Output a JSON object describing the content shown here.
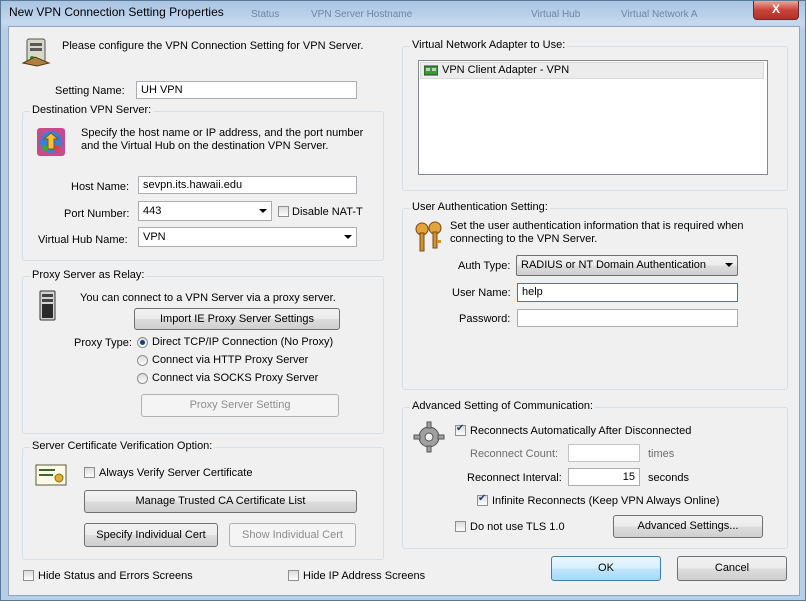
{
  "window": {
    "title": "New VPN Connection Setting Properties",
    "background_headers": [
      "Status",
      "VPN Server Hostname",
      "Virtual Hub",
      "Virtual Network A"
    ],
    "close_label": "X"
  },
  "intro": {
    "text": "Please configure the VPN Connection Setting for VPN Server."
  },
  "setting_name": {
    "label": "Setting Name:",
    "value": "UH VPN"
  },
  "destination": {
    "title": "Destination VPN Server:",
    "description": [
      "Specify the host name or IP address, and the port number",
      "and the Virtual Hub on the destination VPN Server."
    ],
    "host_label": "Host Name:",
    "host_value": "sevpn.its.hawaii.edu",
    "port_label": "Port Number:",
    "port_value": "443",
    "nat_label": "Disable NAT-T",
    "hub_label": "Virtual Hub Name:",
    "hub_value": "VPN"
  },
  "proxy": {
    "title": "Proxy Server as Relay:",
    "description": "You can connect to a VPN Server via a proxy server.",
    "import_button": "Import IE Proxy Server Settings",
    "type_label": "Proxy Type:",
    "options": [
      "Direct TCP/IP Connection (No Proxy)",
      "Connect via HTTP Proxy Server",
      "Connect via SOCKS Proxy Server"
    ],
    "setting_button": "Proxy Server Setting"
  },
  "certificate": {
    "title": "Server Certificate Verification Option:",
    "verify_label": "Always Verify Server Certificate",
    "manage_button": "Manage Trusted CA Certificate List",
    "specify_button": "Specify Individual Cert",
    "show_button": "Show Individual Cert"
  },
  "adapter": {
    "title": "Virtual Network Adapter to Use:",
    "items": [
      "VPN Client Adapter - VPN"
    ]
  },
  "auth": {
    "title": "User Authentication Setting:",
    "description": [
      "Set the user authentication information that is required when",
      "connecting to the VPN Server."
    ],
    "type_label": "Auth Type:",
    "type_value": "RADIUS or NT Domain Authentication",
    "user_label": "User Name:",
    "user_value": "help",
    "password_label": "Password:",
    "password_value": ""
  },
  "advanced": {
    "title": "Advanced Setting of Communication:",
    "reconnect_label": "Reconnects Automatically After Disconnected",
    "count_label": "Reconnect Count:",
    "count_unit": "times",
    "interval_label": "Reconnect Interval:",
    "interval_value": "15",
    "interval_unit": "seconds",
    "infinite_label": "Infinite Reconnects (Keep VPN Always Online)",
    "tls_label": "Do not use TLS 1.0",
    "advanced_button": "Advanced Settings..."
  },
  "footer": {
    "hide_status_label": "Hide Status and Errors Screens",
    "hide_ip_label": "Hide IP Address Screens",
    "ok_button": "OK",
    "cancel_button": "Cancel"
  },
  "colors": {
    "window_frame": "#a9c4e2",
    "client_bg": "#f0f0f0",
    "close_button": "#c8443a",
    "group_border": "#d5dfe5"
  }
}
